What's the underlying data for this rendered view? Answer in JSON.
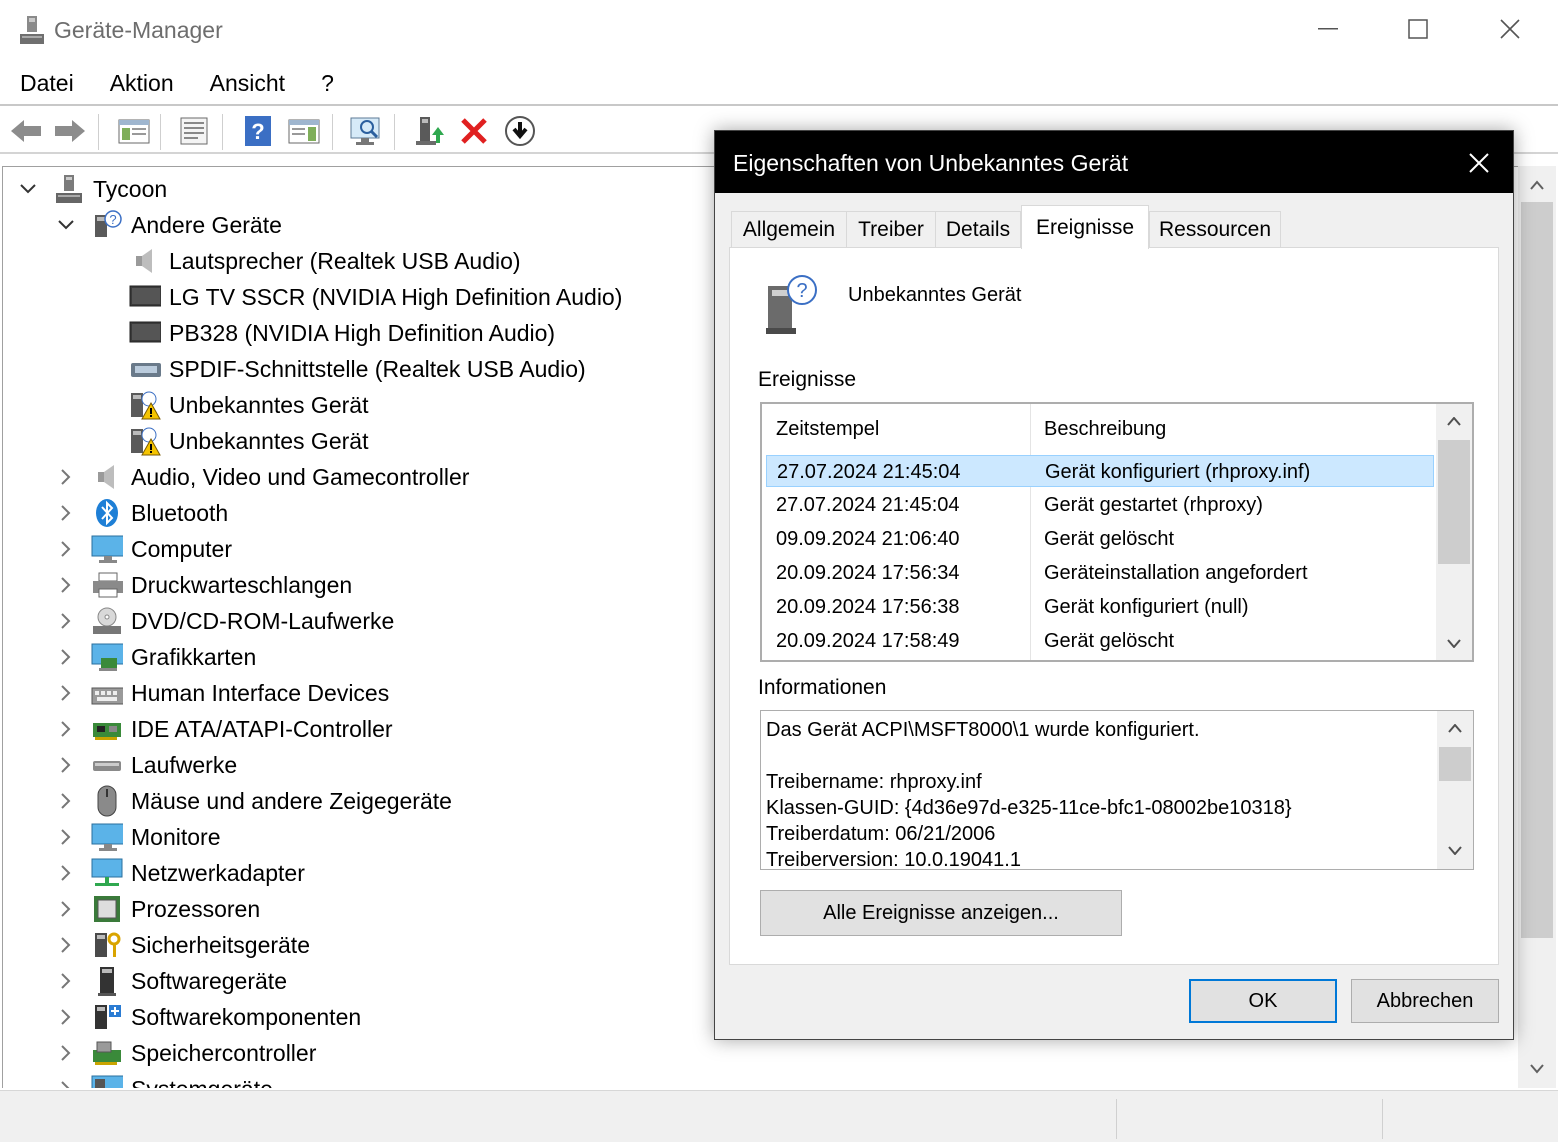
{
  "window": {
    "title": "Geräte-Manager"
  },
  "menu": {
    "items": [
      "Datei",
      "Aktion",
      "Ansicht",
      "?"
    ]
  },
  "tree": {
    "root": "Tycoon",
    "andere": "Andere Geräte",
    "children": [
      "Lautsprecher (Realtek USB Audio)",
      "LG TV SSCR (NVIDIA High Definition Audio)",
      "PB328 (NVIDIA High Definition Audio)",
      "SPDIF-Schnittstelle (Realtek USB Audio)",
      "Unbekanntes Gerät",
      "Unbekanntes Gerät"
    ],
    "categories": [
      "Audio, Video und Gamecontroller",
      "Bluetooth",
      "Computer",
      "Druckwarteschlangen",
      "DVD/CD-ROM-Laufwerke",
      "Grafikkarten",
      "Human Interface Devices",
      "IDE ATA/ATAPI-Controller",
      "Laufwerke",
      "Mäuse und andere Zeigegeräte",
      "Monitore",
      "Netzwerkadapter",
      "Prozessoren",
      "Sicherheitsgeräte",
      "Softwaregeräte",
      "Softwarekomponenten",
      "Speichercontroller",
      "Systemgeräte"
    ]
  },
  "dialog": {
    "title": "Eigenschaften von Unbekanntes Gerät",
    "tabs": [
      "Allgemein",
      "Treiber",
      "Details",
      "Ereignisse",
      "Ressourcen"
    ],
    "active_tab": "Ereignisse",
    "device_name": "Unbekanntes Gerät",
    "events_label": "Ereignisse",
    "col_time": "Zeitstempel",
    "col_desc": "Beschreibung",
    "events": [
      {
        "time": "27.07.2024 21:45:04",
        "desc": "Gerät konfiguriert (rhproxy.inf)"
      },
      {
        "time": "27.07.2024 21:45:04",
        "desc": "Gerät gestartet (rhproxy)"
      },
      {
        "time": "09.09.2024 21:06:40",
        "desc": "Gerät gelöscht"
      },
      {
        "time": "20.09.2024 17:56:34",
        "desc": "Geräteinstallation angefordert"
      },
      {
        "time": "20.09.2024 17:56:38",
        "desc": "Gerät konfiguriert (null)"
      },
      {
        "time": "20.09.2024 17:58:49",
        "desc": "Gerät gelöscht"
      }
    ],
    "info_label": "Informationen",
    "info_lines": [
      "Das Gerät ACPI\\MSFT8000\\1 wurde konfiguriert.",
      "",
      "Treibername: rhproxy.inf",
      "Klassen-GUID: {4d36e97d-e325-11ce-bfc1-08002be10318}",
      "Treiberdatum: 06/21/2006",
      "Treiberversion: 10.0.19041.1"
    ],
    "all_events_button": "Alle Ereignisse anzeigen...",
    "ok_button": "OK",
    "cancel_button": "Abbrechen"
  }
}
